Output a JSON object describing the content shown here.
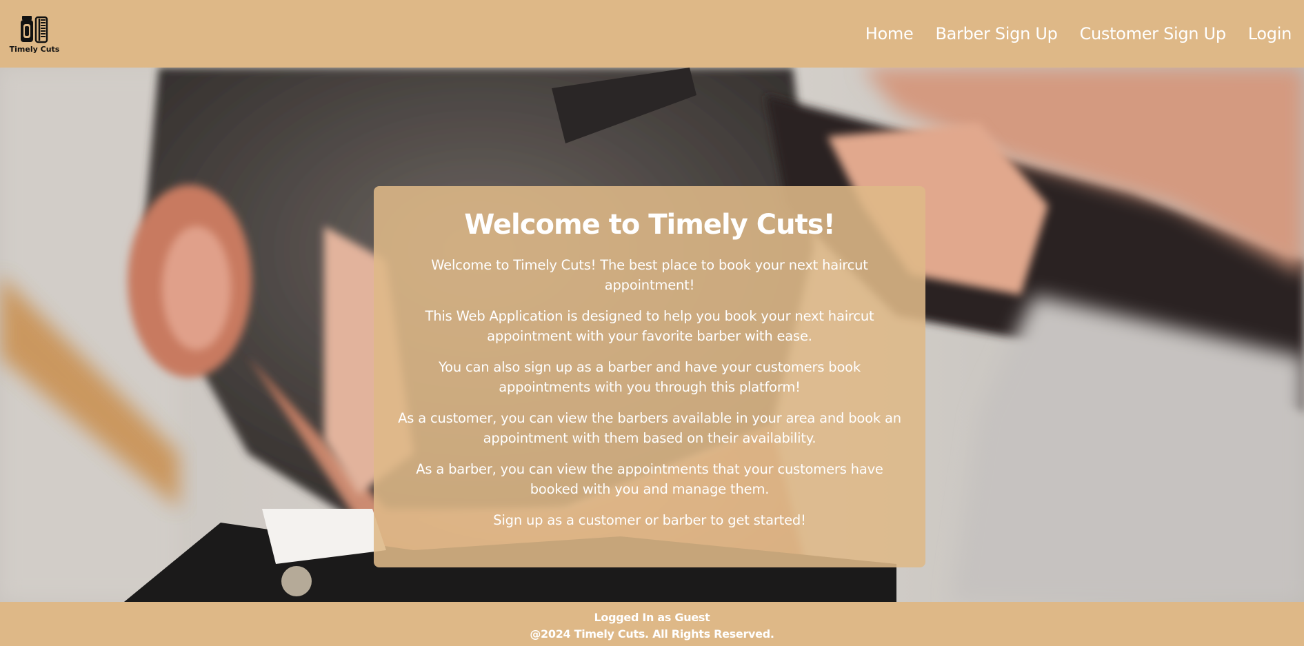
{
  "brand": {
    "name": "Timely Cuts",
    "logo_icon": "clipper-and-comb-icon"
  },
  "nav": {
    "items": [
      {
        "label": "Home"
      },
      {
        "label": "Barber Sign Up"
      },
      {
        "label": "Customer Sign Up"
      },
      {
        "label": "Login"
      }
    ]
  },
  "hero": {
    "background": "barber-cutting-hair-photo"
  },
  "welcome": {
    "title": "Welcome to Timely Cuts!",
    "paragraphs": [
      "Welcome to Timely Cuts! The best place to book your next haircut appointment!",
      "This Web Application is designed to help you book your next haircut appointment with your favorite barber with ease.",
      "You can also sign up as a barber and have your customers book appointments with you through this platform!",
      "As a customer, you can view the barbers available in your area and book an appointment with them based on their availability.",
      "As a barber, you can view the appointments that your customers have booked with you and manage them.",
      "Sign up as a customer or barber to get started!"
    ]
  },
  "footer": {
    "status": "Logged In as Guest",
    "copyright": "@2024 Timely Cuts. All Rights Reserved."
  },
  "colors": {
    "accent": "#deb887",
    "text_light": "#ffffff"
  }
}
